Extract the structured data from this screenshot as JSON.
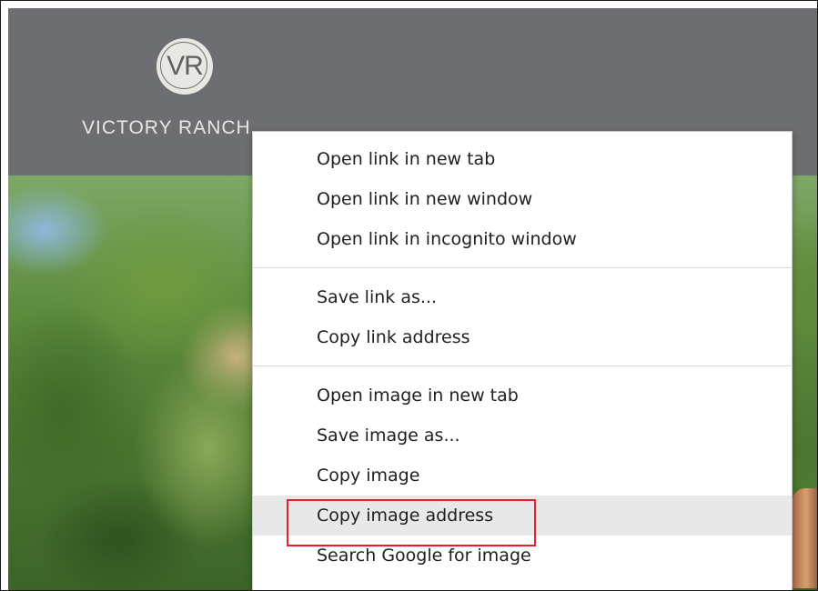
{
  "site": {
    "logo_monogram": "VR",
    "logo_wordmark": "VICTORY RANCH"
  },
  "context_menu": {
    "groups": [
      {
        "items": [
          {
            "label": "Open link in new tab"
          },
          {
            "label": "Open link in new window"
          },
          {
            "label": "Open link in incognito window"
          }
        ]
      },
      {
        "items": [
          {
            "label": "Save link as..."
          },
          {
            "label": "Copy link address"
          }
        ]
      },
      {
        "items": [
          {
            "label": "Open image in new tab"
          },
          {
            "label": "Save image as..."
          },
          {
            "label": "Copy image"
          },
          {
            "label": "Copy image address",
            "state": "hovered",
            "annotation": "highlighted"
          },
          {
            "label": "Search Google for image"
          }
        ]
      }
    ]
  },
  "colors": {
    "header_bg": "#6d6e71",
    "highlight_border": "#e5202a",
    "menu_hover_bg": "#e8e8e8"
  }
}
